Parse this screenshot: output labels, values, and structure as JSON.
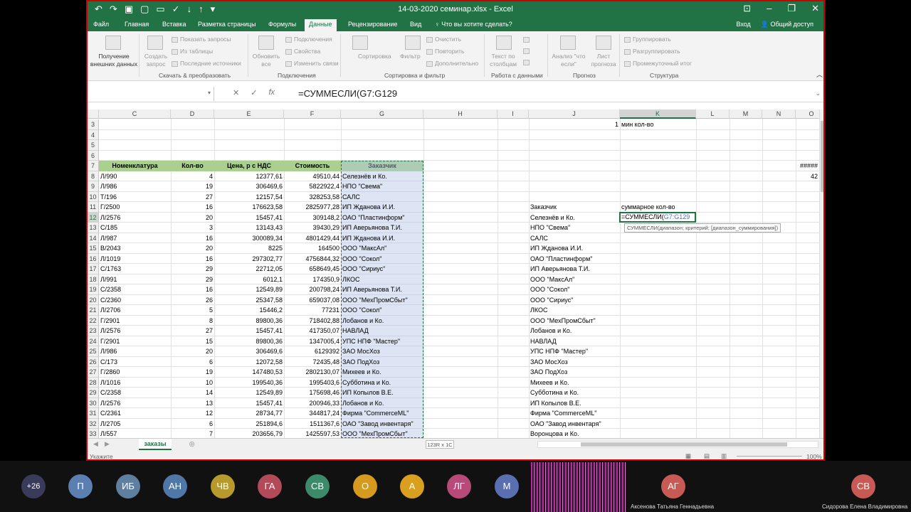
{
  "window": {
    "title": "14-03-2020 семинар.xlsx - Excel",
    "tabs": [
      "Файл",
      "Главная",
      "Вставка",
      "Разметка страницы",
      "Формулы",
      "Данные",
      "Рецензирование",
      "Вид"
    ],
    "active_tab": "Данные",
    "tell_me": "Что вы хотите сделать?",
    "signin": "Вход",
    "share": "Общий доступ"
  },
  "ribbon": {
    "get_data": "Получение внешних данных",
    "create_query": "Создать запрос",
    "show_queries": "Показать запросы",
    "from_table": "Из таблицы",
    "recent_sources": "Последние источники",
    "group1": "Скачать & преобразовать",
    "refresh_all": "Обновить все",
    "connections": "Подключения",
    "properties": "Свойства",
    "edit_links": "Изменить связи",
    "group2": "Подключения",
    "sort": "Сортировка",
    "filter": "Фильтр",
    "clear": "Очистить",
    "reapply": "Повторить",
    "advanced": "Дополнительно",
    "group3": "Сортировка и фильтр",
    "text_to_cols": "Текст по столбцам",
    "group4": "Работа с данными",
    "whatif": "Анализ \"что если\"",
    "forecast": "Лист прогноза",
    "group5": "Прогноз",
    "group_btn": "Группировать",
    "ungroup_btn": "Разгруппировать",
    "subtotal": "Промежуточный итог",
    "group6": "Структура"
  },
  "formula_bar": {
    "formula": "=СУММЕСЛИ(G7:G129",
    "cancel": "✕",
    "enter": "✓",
    "fx": "fx"
  },
  "columns": [
    "C",
    "D",
    "E",
    "F",
    "G",
    "H",
    "I",
    "J",
    "K",
    "L",
    "M",
    "N",
    "O"
  ],
  "row_numbers": [
    "3",
    "4",
    "5",
    "6",
    "7",
    "8",
    "9",
    "10",
    "11",
    "12",
    "13",
    "14",
    "15",
    "16",
    "17",
    "18",
    "19",
    "20",
    "21",
    "22",
    "23",
    "24",
    "25",
    "26",
    "27",
    "28",
    "29",
    "30",
    "31",
    "32",
    "33"
  ],
  "table_header": {
    "c": "Номенклатура",
    "d": "Кол-во",
    "e": "Цена, р с НДС",
    "f": "Стоимость",
    "g": "Заказчик"
  },
  "rows": [
    {
      "c": "Л/990",
      "d": "4",
      "e": "12377,61",
      "f": "49510,44",
      "g": "Селезнёв и Ко."
    },
    {
      "c": "Л/986",
      "d": "19",
      "e": "306469,6",
      "f": "5822922,4",
      "g": "НПО \"Свема\""
    },
    {
      "c": "Т/196",
      "d": "27",
      "e": "12157,54",
      "f": "328253,58",
      "g": "САЛС"
    },
    {
      "c": "Г/2500",
      "d": "16",
      "e": "176623,58",
      "f": "2825977,28",
      "g": "ИП Жданова И.И."
    },
    {
      "c": "Л/2576",
      "d": "20",
      "e": "15457,41",
      "f": "309148,2",
      "g": "ОАО \"Пластинформ\""
    },
    {
      "c": "С/185",
      "d": "3",
      "e": "13143,43",
      "f": "39430,29",
      "g": "ИП Аверьянова Т.И."
    },
    {
      "c": "Л/987",
      "d": "16",
      "e": "300089,34",
      "f": "4801429,44",
      "g": "ИП Жданова И.И."
    },
    {
      "c": "В/2043",
      "d": "20",
      "e": "8225",
      "f": "164500",
      "g": "ООО \"МаксАл\""
    },
    {
      "c": "Л/1019",
      "d": "16",
      "e": "297302,77",
      "f": "4756844,32",
      "g": "ООО \"Сокол\""
    },
    {
      "c": "С/1763",
      "d": "29",
      "e": "22712,05",
      "f": "658649,45",
      "g": "ООО \"Сириус\""
    },
    {
      "c": "Л/991",
      "d": "29",
      "e": "6012,1",
      "f": "174350,9",
      "g": "ЛКОС"
    },
    {
      "c": "С/2358",
      "d": "16",
      "e": "12549,89",
      "f": "200798,24",
      "g": "ИП Аверьянова Т.И."
    },
    {
      "c": "С/2360",
      "d": "26",
      "e": "25347,58",
      "f": "659037,08",
      "g": "ООО \"МехПромСбыт\""
    },
    {
      "c": "Л/2706",
      "d": "5",
      "e": "15446,2",
      "f": "77231",
      "g": "ООО \"Сокол\""
    },
    {
      "c": "Г/2901",
      "d": "8",
      "e": "89800,36",
      "f": "718402,88",
      "g": "Лобанов и Ко."
    },
    {
      "c": "Л/2576",
      "d": "27",
      "e": "15457,41",
      "f": "417350,07",
      "g": "НАВЛАД"
    },
    {
      "c": "Г/2901",
      "d": "15",
      "e": "89800,36",
      "f": "1347005,4",
      "g": "УПС НПФ \"Мастер\""
    },
    {
      "c": "Л/986",
      "d": "20",
      "e": "306469,6",
      "f": "6129392",
      "g": "ЗАО МосХоз"
    },
    {
      "c": "С/173",
      "d": "6",
      "e": "12072,58",
      "f": "72435,48",
      "g": "ЗАО ПодХоз"
    },
    {
      "c": "Г/2860",
      "d": "19",
      "e": "147480,53",
      "f": "2802130,07",
      "g": "Михеев и Ко."
    },
    {
      "c": "Л/1016",
      "d": "10",
      "e": "199540,36",
      "f": "1995403,6",
      "g": "Субботина и Ко."
    },
    {
      "c": "С/2358",
      "d": "14",
      "e": "12549,89",
      "f": "175698,46",
      "g": "ИП Копылов В.Е."
    },
    {
      "c": "Л/2576",
      "d": "13",
      "e": "15457,41",
      "f": "200946,33",
      "g": "Лобанов и Ко."
    },
    {
      "c": "С/2361",
      "d": "12",
      "e": "28734,77",
      "f": "344817,24",
      "g": "Фирма \"CommerceML\""
    },
    {
      "c": "Л/2705",
      "d": "6",
      "e": "251894,6",
      "f": "1511367,6",
      "g": "ОАО \"Завод инвентаря\""
    },
    {
      "c": "Л/557",
      "d": "7",
      "e": "203656,79",
      "f": "1425597,53",
      "g": "ООО \"МехПромСбыт\""
    }
  ],
  "right": {
    "row3_j": "1",
    "row3_k": "мин кол-во",
    "j_header": "Заказчик",
    "k_header": "суммарное  кол-во",
    "active_formula": "=СУММЕСЛИ(",
    "active_ref": "G7:G129",
    "tooltip": "СУММЕСЛИ(диапазон; критерий; [диапазон_суммирования])",
    "customers": [
      "Селезнёв и Ко.",
      "НПО \"Свема\"",
      "САЛС",
      "ИП Жданова И.И.",
      "ОАО \"Пластинформ\"",
      "ИП Аверьянова Т.И.",
      "ООО \"МаксАл\"",
      "ООО \"Сокол\"",
      "ООО \"Сириус\"",
      "ЛКОС",
      "ООО \"МехПромСбыт\"",
      "Лобанов и Ко.",
      "НАВЛАД",
      "УПС НПФ \"Мастер\"",
      "ЗАО МосХоз",
      "ЗАО ПодХоз",
      "Михеев и Ко.",
      "Субботина и Ко.",
      "ИП Копылов В.Е.",
      "Фирма \"CommerceML\"",
      "ОАО \"Завод инвентаря\"",
      "Воронцова и Ко."
    ],
    "o7": "#####",
    "o8": "42"
  },
  "sheet": {
    "tab": "заказы",
    "selection_info": "123R x 1C",
    "status": "Укажите",
    "zoom": "100%"
  },
  "participants": [
    {
      "initials": "+26",
      "color": "#3a3a5a"
    },
    {
      "initials": "П",
      "color": "#5b7fb0"
    },
    {
      "initials": "ИБ",
      "color": "#5f7fa0"
    },
    {
      "initials": "АН",
      "color": "#4f78a8"
    },
    {
      "initials": "ЧВ",
      "color": "#b79a2b"
    },
    {
      "initials": "ГА",
      "color": "#b24a5a"
    },
    {
      "initials": "СВ",
      "color": "#3c8a6a"
    },
    {
      "initials": "О",
      "color": "#d59a1e"
    },
    {
      "initials": "А",
      "color": "#d9a020"
    },
    {
      "initials": "ЛГ",
      "color": "#b84a7a"
    },
    {
      "initials": "М",
      "color": "#5a6fb0"
    }
  ],
  "tile_a": {
    "initials": "АГ",
    "name": "Аксенова Татьяна Геннадьевна",
    "color": "#c85a55"
  },
  "tile_b": {
    "initials": "СВ",
    "name": "Сидорова Елена Владимировна",
    "color": "#c85a55"
  }
}
